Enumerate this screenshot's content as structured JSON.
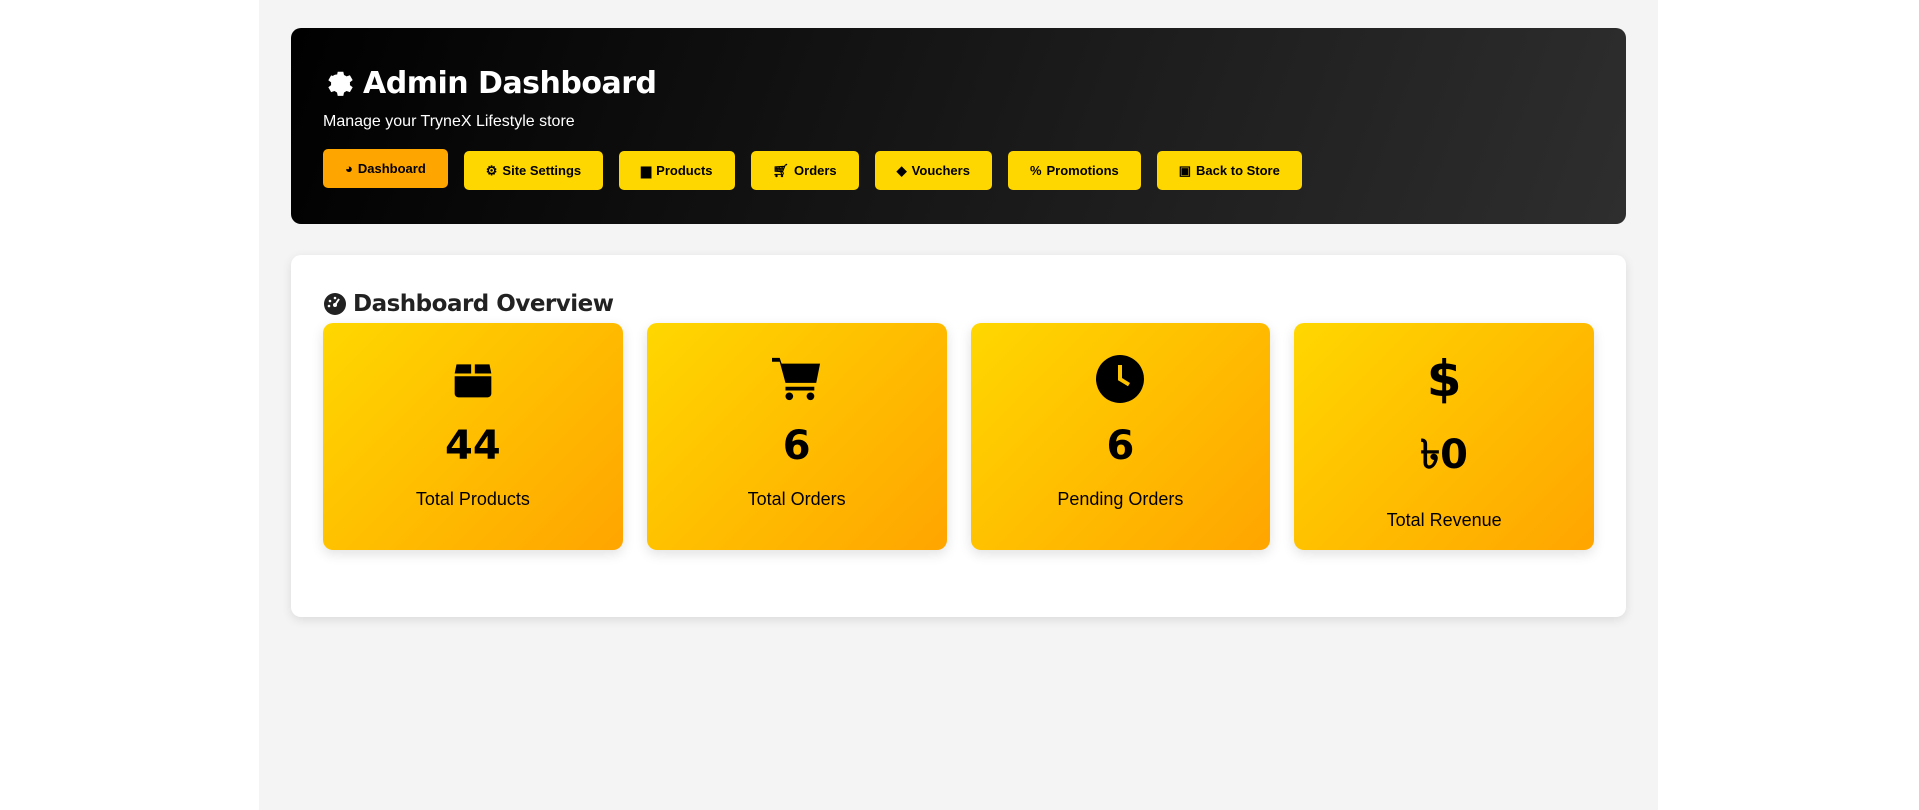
{
  "header": {
    "title": "Admin Dashboard",
    "subtitle": "Manage your TryneX Lifestyle store"
  },
  "nav": [
    {
      "label": "Dashboard",
      "icon": "gauge-icon",
      "active": true
    },
    {
      "label": "Site Settings",
      "icon": "gear-icon"
    },
    {
      "label": "Products",
      "icon": "box-icon"
    },
    {
      "label": "Orders",
      "icon": "cart-icon"
    },
    {
      "label": "Vouchers",
      "icon": "tags-icon"
    },
    {
      "label": "Promotions",
      "icon": "percent-icon"
    },
    {
      "label": "Back to Store",
      "icon": "store-icon"
    }
  ],
  "overview": {
    "title": "Dashboard Overview",
    "cards": [
      {
        "value": "44",
        "label": "Total Products",
        "icon": "box-icon"
      },
      {
        "value": "6",
        "label": "Total Orders",
        "icon": "cart-icon"
      },
      {
        "value": "6",
        "label": "Pending Orders",
        "icon": "clock-icon"
      },
      {
        "value": "৳0",
        "label": "Total Revenue",
        "icon": "dollar-icon"
      }
    ]
  },
  "colors": {
    "accent": "#ffd700",
    "active": "#ffa500"
  }
}
